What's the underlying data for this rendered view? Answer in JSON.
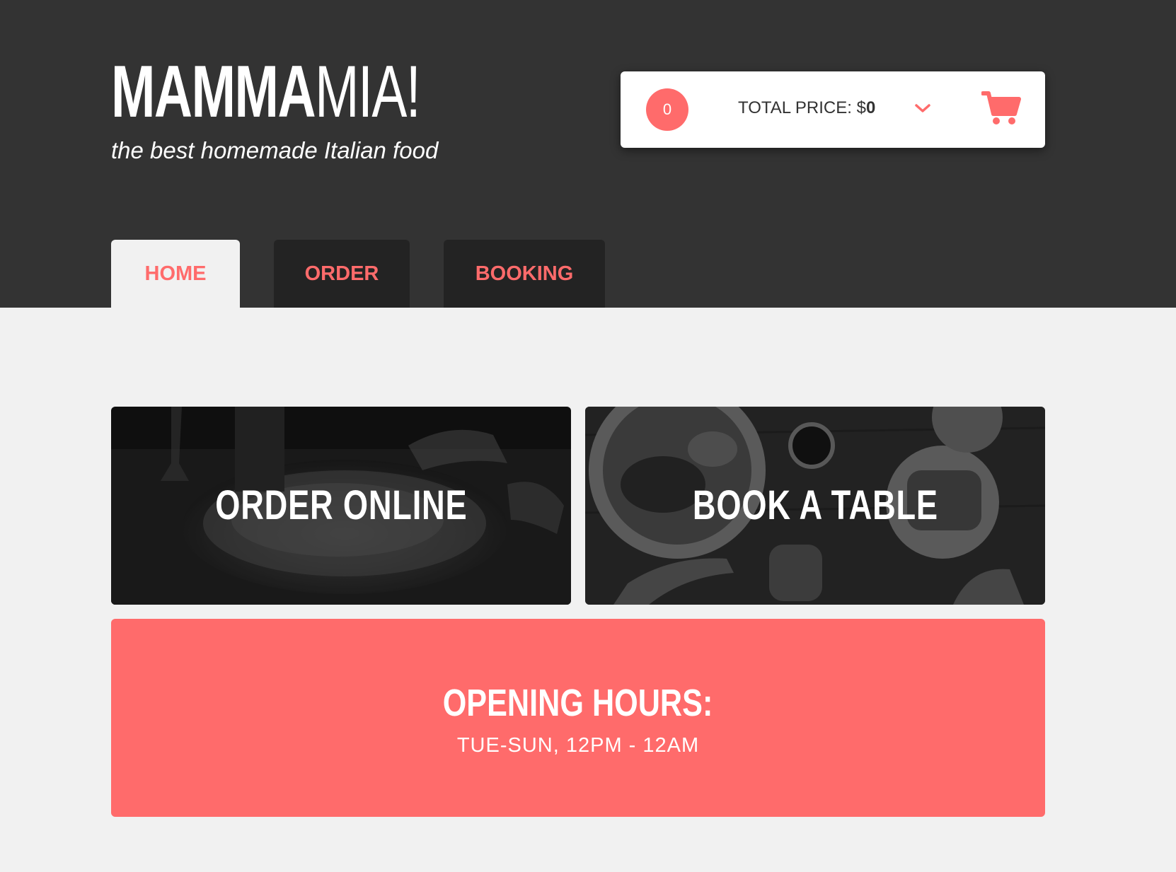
{
  "brand": {
    "logo_bold": "MAMMA",
    "logo_light": "MIA!",
    "tagline": "the best homemade Italian food"
  },
  "cart": {
    "count": "0",
    "total_label": "TOTAL PRICE: $",
    "total_value": "0",
    "icons": [
      "chevron-down-icon",
      "shopping-cart-icon"
    ]
  },
  "nav": {
    "tabs": [
      {
        "label": "HOME",
        "active": true
      },
      {
        "label": "ORDER",
        "active": false
      },
      {
        "label": "BOOKING",
        "active": false
      }
    ]
  },
  "cards": {
    "order": {
      "title": "ORDER ONLINE"
    },
    "book": {
      "title": "BOOK A TABLE"
    }
  },
  "hours": {
    "title": "OPENING HOURS:",
    "time": "TUE-SUN, 12PM - 12AM"
  },
  "colors": {
    "accent": "#ff6b6b",
    "header_bg": "#333333",
    "tab_bg": "#232323",
    "page_bg": "#f1f1f1"
  }
}
